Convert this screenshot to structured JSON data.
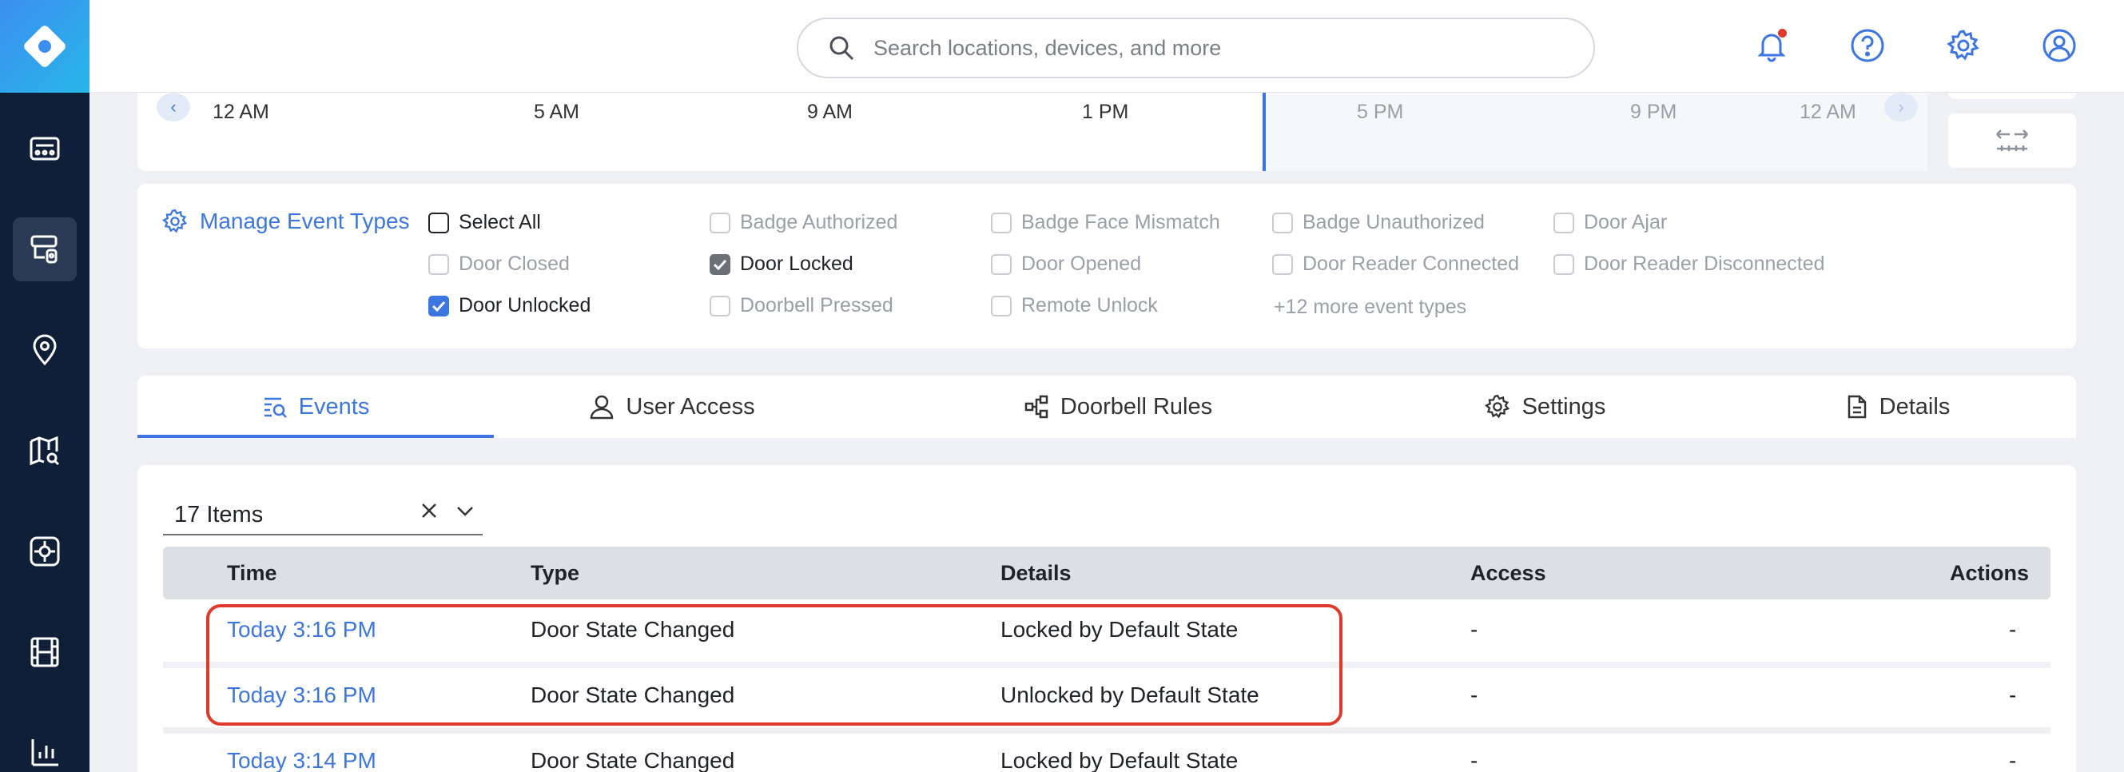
{
  "search": {
    "placeholder": "Search locations, devices, and more"
  },
  "timeline": {
    "labels_past": [
      "12 AM",
      "5 AM",
      "9 AM",
      "1 PM"
    ],
    "labels_future": [
      "5 PM",
      "9 PM",
      "12 AM"
    ]
  },
  "filters": {
    "manage_label": "Manage Event Types",
    "checkboxes": [
      {
        "label": "Select All",
        "checked": false,
        "enabled": true
      },
      {
        "label": "Badge Authorized",
        "checked": false,
        "enabled": false
      },
      {
        "label": "Badge Face Mismatch",
        "checked": false,
        "enabled": false
      },
      {
        "label": "Badge Unauthorized",
        "checked": false,
        "enabled": false
      },
      {
        "label": "Door Ajar",
        "checked": false,
        "enabled": false
      },
      {
        "label": "Door Closed",
        "checked": false,
        "enabled": false
      },
      {
        "label": "Door Locked",
        "checked": true,
        "enabled": true
      },
      {
        "label": "Door Opened",
        "checked": false,
        "enabled": false
      },
      {
        "label": "Door Reader Connected",
        "checked": false,
        "enabled": false
      },
      {
        "label": "Door Reader Disconnected",
        "checked": false,
        "enabled": false
      },
      {
        "label": "Door Unlocked",
        "checked": true,
        "enabled": true
      },
      {
        "label": "Doorbell Pressed",
        "checked": false,
        "enabled": false
      },
      {
        "label": "Remote Unlock",
        "checked": false,
        "enabled": false
      }
    ],
    "more_label": "+12 more event types"
  },
  "tabs": [
    {
      "label": "Events",
      "active": true
    },
    {
      "label": "User Access",
      "active": false
    },
    {
      "label": "Doorbell Rules",
      "active": false
    },
    {
      "label": "Settings",
      "active": false
    },
    {
      "label": "Details",
      "active": false
    }
  ],
  "events": {
    "items_count_label": "17 Items",
    "columns": [
      "Time",
      "Type",
      "Details",
      "Access",
      "Actions"
    ],
    "rows": [
      {
        "time": "Today 3:16 PM",
        "type": "Door State Changed",
        "details": "Locked by Default State",
        "access": "-",
        "actions": "-"
      },
      {
        "time": "Today 3:16 PM",
        "type": "Door State Changed",
        "details": "Unlocked by Default State",
        "access": "-",
        "actions": "-"
      },
      {
        "time": "Today 3:14 PM",
        "type": "Door State Changed",
        "details": "Locked by Default State",
        "access": "-",
        "actions": "-"
      }
    ]
  },
  "colors": {
    "accent": "#3d76e0",
    "sidebar": "#0f1f38",
    "highlight": "#e0392b",
    "notification": "#e03a2f"
  }
}
